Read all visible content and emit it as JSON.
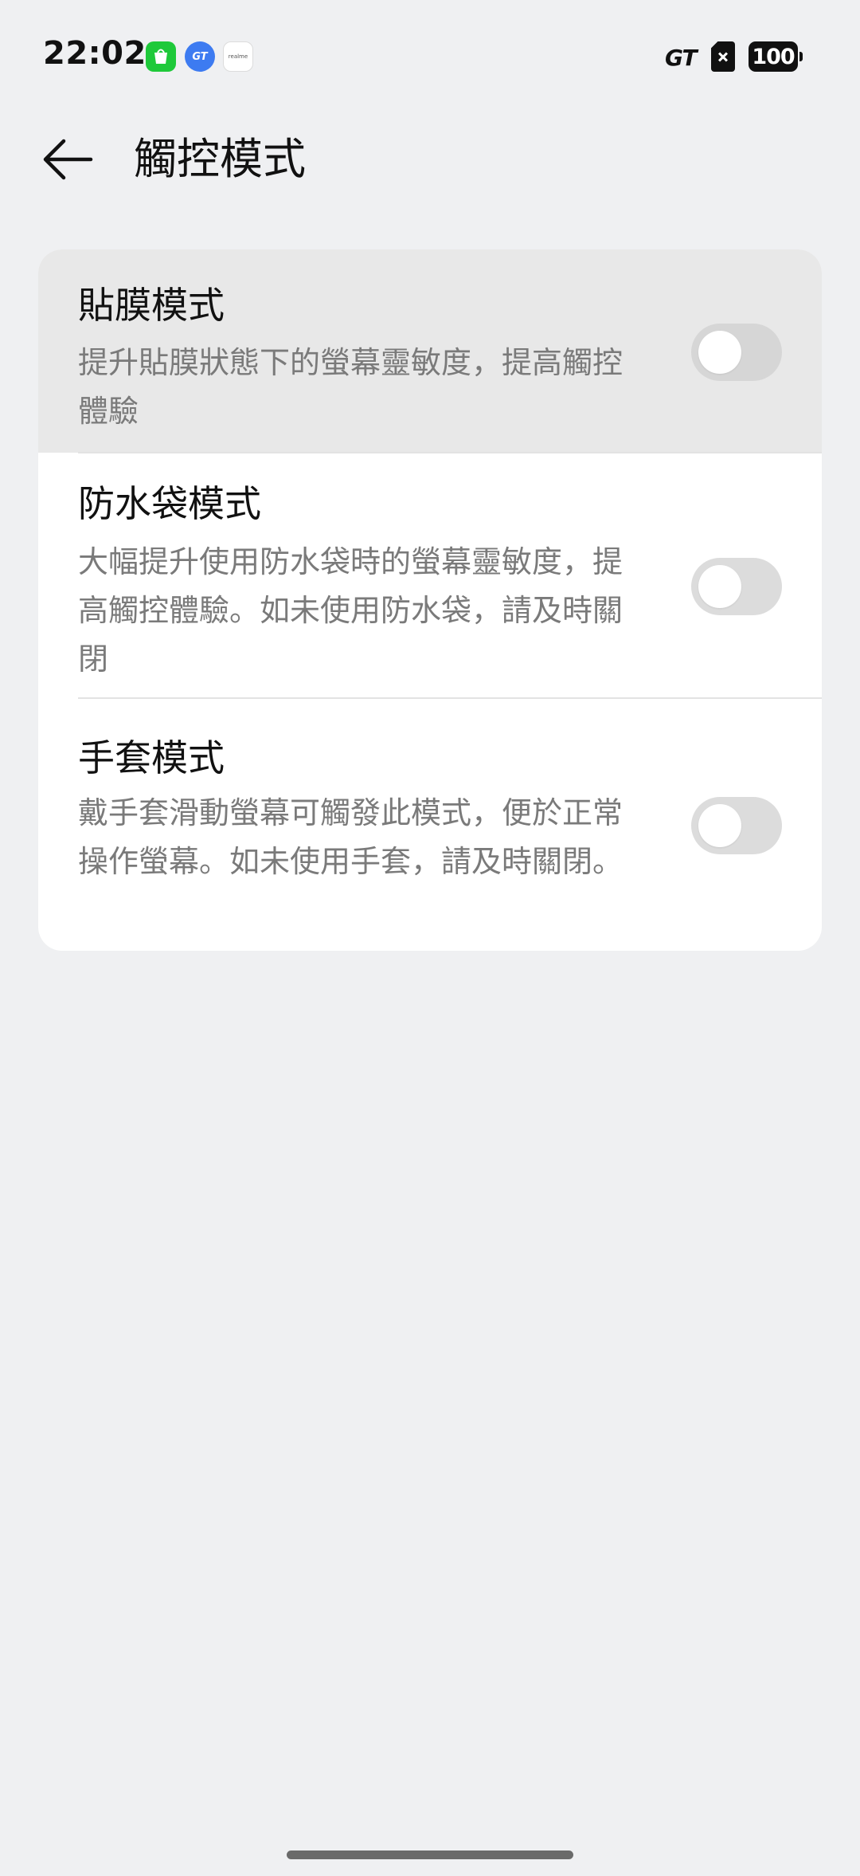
{
  "status_bar": {
    "time": "22:02",
    "notifications": [
      "shop-app-icon",
      "gt-app-icon",
      "realme-app-icon"
    ],
    "gt_mode_label": "GT",
    "battery_level": "100"
  },
  "header": {
    "title": "觸控模式",
    "back_icon": "arrow-left-icon"
  },
  "settings": [
    {
      "title": "貼膜模式",
      "description": "提升貼膜狀態下的螢幕靈敏度，提高觸控體驗",
      "enabled": false
    },
    {
      "title": "防水袋模式",
      "description": "大幅提升使用防水袋時的螢幕靈敏度，提高觸控體驗。如未使用防水袋，請及時關閉",
      "enabled": false
    },
    {
      "title": "手套模式",
      "description": "戴手套滑動螢幕可觸發此模式，便於正常操作螢幕。如未使用手套，請及時關閉。",
      "enabled": false
    }
  ],
  "colors": {
    "page_background": "#eff0f2",
    "card_background": "#ffffff",
    "pressed_row_background": "#e8e8e8",
    "toggle_off": "#dcdcdc",
    "description_text": "#7a7a7a"
  }
}
